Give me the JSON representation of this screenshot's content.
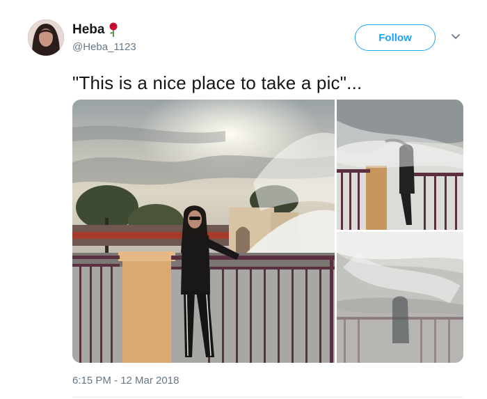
{
  "author": {
    "name": "Heba",
    "handle": "@Heba_1123",
    "avatar_icon": "avatar",
    "name_emoji_icon": "rose-icon"
  },
  "follow_button": {
    "label": "Follow"
  },
  "menu": {
    "icon": "chevron-down-icon"
  },
  "tweet": {
    "text": "\"This is a nice place to take a pic\"...",
    "timestamp": "6:15 PM - 12 Mar 2018"
  },
  "colors": {
    "accent": "#1da1f2",
    "secondary_text": "#657786",
    "primary_text": "#14171a"
  }
}
